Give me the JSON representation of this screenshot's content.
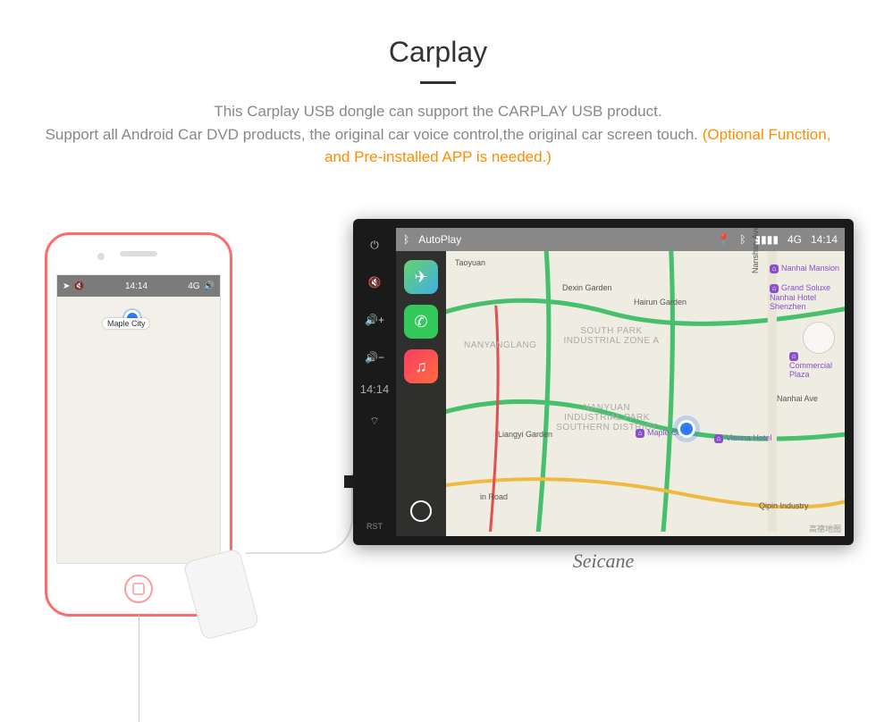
{
  "header": {
    "title": "Carplay",
    "desc_part1": "This Carplay USB dongle can support the CARPLAY USB product.",
    "desc_part2": "Support all Android Car DVD products, the original car voice control,the original car screen touch.",
    "desc_note": "(Optional Function, and Pre-installed APP is needed.)"
  },
  "phone": {
    "statusbar": {
      "time": "14:14",
      "signal_label": "4G"
    },
    "map": {
      "label_maplecity": "Maple City"
    }
  },
  "unit": {
    "sidebuttons": {
      "power": "power-icon",
      "mute": "mute-icon",
      "vol_up": "volume-up-icon",
      "vol_down": "volume-down-icon",
      "clock": "14:14",
      "wifi": "wifi-icon",
      "rst": "RST"
    },
    "topbar": {
      "app": "AutoPlay",
      "signal_label": "4G",
      "time": "14:14"
    },
    "dock": {
      "maps": "maps-icon",
      "phone": "phone-icon",
      "music": "music-icon",
      "home": "home-icon"
    },
    "map": {
      "zones": {
        "nanyanglang": "NANYANGLANG",
        "southpark_a": "SOUTH PARK INDUSTRIAL ZONE A",
        "nanyuan_south": "NANYUAN INDUSTRIAL PARK SOUTHERN DISTRICT"
      },
      "labels": {
        "taoyuan": "Taoyuan",
        "dexin": "Dexin Garden",
        "hairun": "Hairun Garden",
        "nanshan_ave": "Nanshan Avenue",
        "liangyi": "Liangyi Garden",
        "nanhai_ave": "Nanhai Ave",
        "in_road": "in Road",
        "qipin": "Qipin Industry"
      },
      "pois": {
        "nanhai_mansion": "Nanhai Mansion",
        "grand_soluxe": "Grand Soluxe Nanhai Hotel Shenzhen",
        "commercial": "Commercial Plaza",
        "maple_city": "Maple City",
        "vienna": "Vienna Hotel"
      },
      "attribution": "高德地图"
    }
  },
  "brand": "Seicane"
}
